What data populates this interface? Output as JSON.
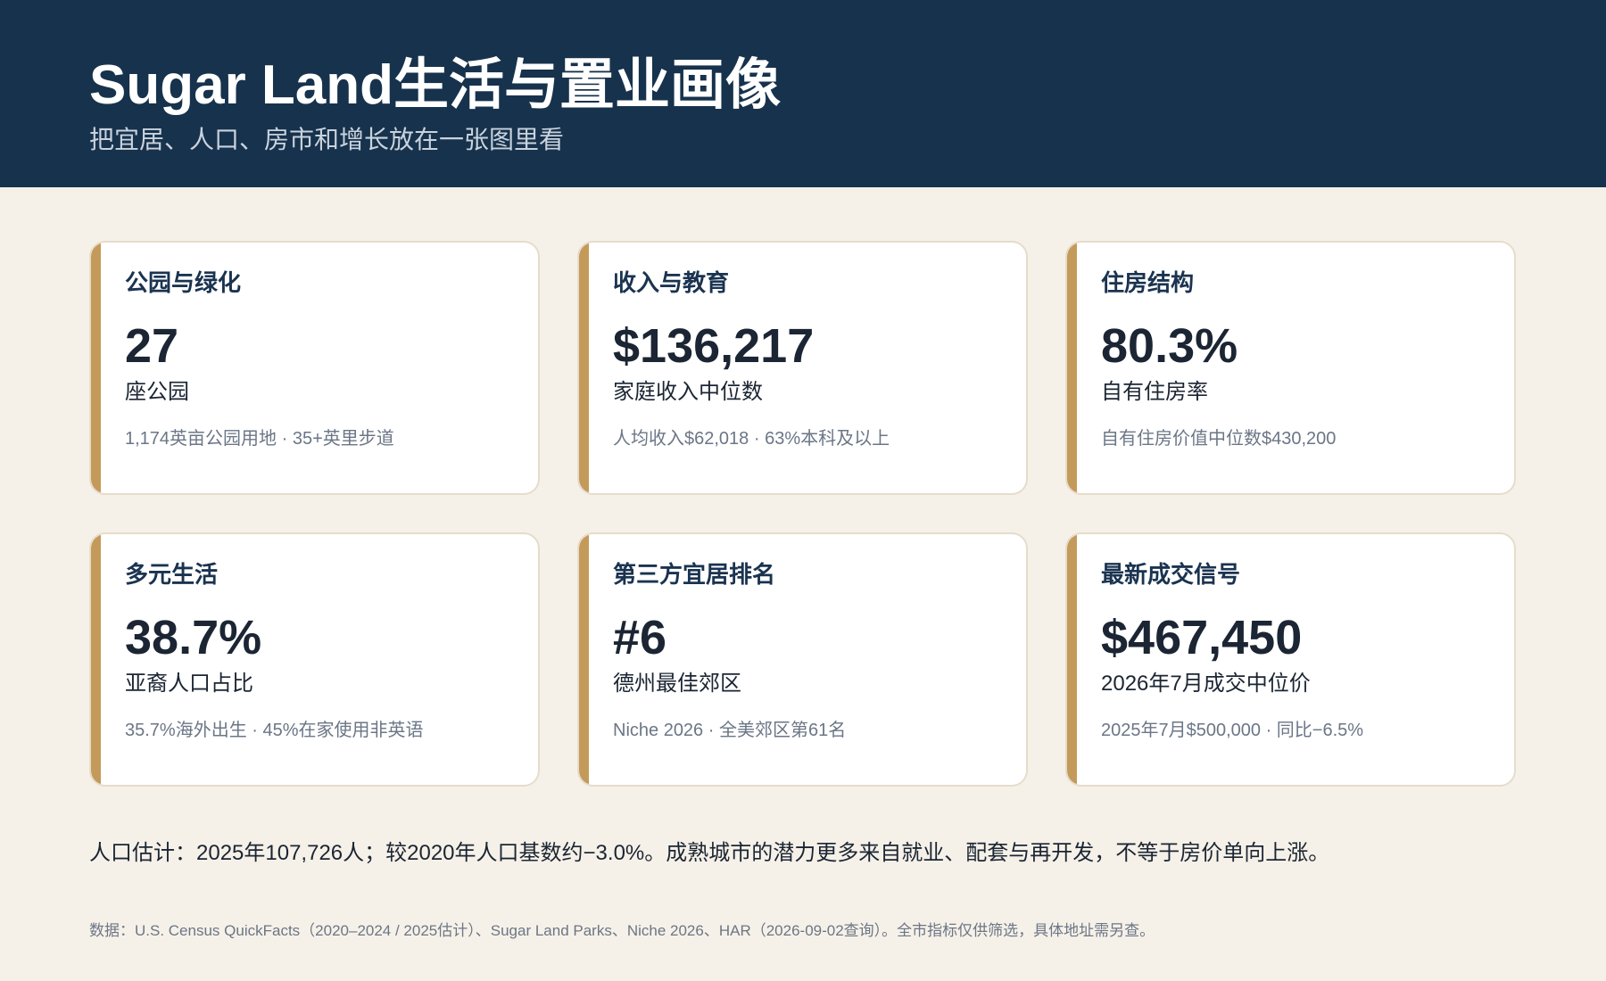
{
  "header": {
    "title": "Sugar Land生活与置业画像",
    "subtitle": "把宜居、人口、房市和增长放在一张图里看"
  },
  "cards": [
    {
      "title": "公园与绿化",
      "value": "27",
      "label": "座公园",
      "note": "1,174英亩公园用地 · 35+英里步道"
    },
    {
      "title": "收入与教育",
      "value": "$136,217",
      "label": "家庭收入中位数",
      "note": "人均收入$62,018 · 63%本科及以上"
    },
    {
      "title": "住房结构",
      "value": "80.3%",
      "label": "自有住房率",
      "note": "自有住房价值中位数$430,200"
    },
    {
      "title": "多元生活",
      "value": "38.7%",
      "label": "亚裔人口占比",
      "note": "35.7%海外出生 · 45%在家使用非英语"
    },
    {
      "title": "第三方宜居排名",
      "value": "#6",
      "label": "德州最佳郊区",
      "note": "Niche 2026 · 全美郊区第61名"
    },
    {
      "title": "最新成交信号",
      "value": "$467,450",
      "label": "2026年7月成交中位价",
      "note": "2025年7月$500,000 · 同比−6.5%"
    }
  ],
  "summary": "人口估计：2025年107,726人；较2020年人口基数约−3.0%。成熟城市的潜力更多来自就业、配套与再开发，不等于房价单向上涨。",
  "source": "数据：U.S. Census QuickFacts（2020–2024 / 2025估计）、Sugar Land Parks、Niche 2026、HAR（2026-09-02查询）。全市指标仅供筛选，具体地址需另查。",
  "colors": {
    "header_bg": "#17324c",
    "page_bg": "#f6f1e8",
    "accent": "#c49a5a",
    "card_border": "#e6dccb"
  }
}
